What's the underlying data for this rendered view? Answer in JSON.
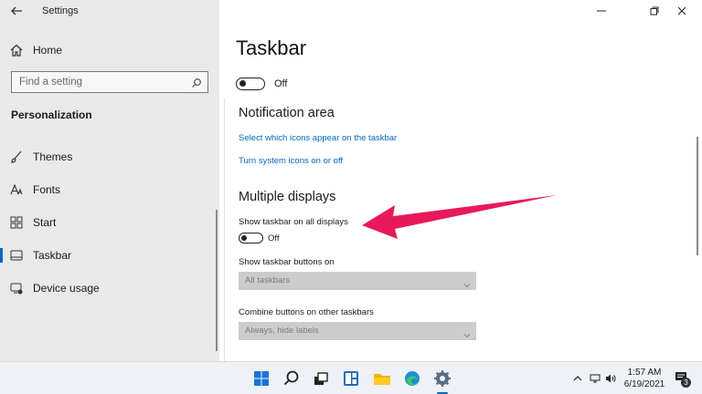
{
  "window": {
    "app_title": "Settings"
  },
  "sidebar": {
    "home_label": "Home",
    "search_placeholder": "Find a setting",
    "section_heading": "Personalization",
    "items": [
      {
        "label": "Themes",
        "icon": "brush-icon",
        "active": false
      },
      {
        "label": "Fonts",
        "icon": "font-icon",
        "active": false
      },
      {
        "label": "Start",
        "icon": "start-icon",
        "active": false
      },
      {
        "label": "Taskbar",
        "icon": "taskbar-icon",
        "active": true
      },
      {
        "label": "Device usage",
        "icon": "device-usage-icon",
        "active": false
      }
    ]
  },
  "main": {
    "title": "Taskbar",
    "top_toggle_state": "Off",
    "notification_heading": "Notification area",
    "link_select_icons": "Select which icons appear on the taskbar",
    "link_system_icons": "Turn system icons on or off",
    "multiple_displays_heading": "Multiple displays",
    "show_all_displays_label": "Show taskbar on all displays",
    "show_all_displays_state": "Off",
    "show_buttons_on_label": "Show taskbar buttons on",
    "show_buttons_on_value": "All taskbars",
    "combine_label": "Combine buttons on other taskbars",
    "combine_value": "Always, hide labels"
  },
  "taskbar": {
    "apps": [
      "windows-start-icon",
      "search-icon",
      "task-view-icon",
      "widgets-icon",
      "file-explorer-icon",
      "edge-icon",
      "settings-gear-icon"
    ],
    "time": "1:57 AM",
    "date": "6/19/2021",
    "notification_count": "3"
  },
  "colors": {
    "accent": "#0067c0",
    "annotation_arrow": "#e8195a",
    "sidebar_bg": "#e9e9e9",
    "taskbar_bg": "#eef1f5"
  }
}
